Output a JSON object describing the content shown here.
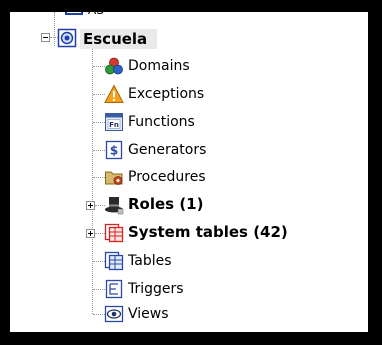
{
  "tree": {
    "partial_top_label": "AS",
    "root": {
      "label": "Escuela",
      "expanded": true
    },
    "items": [
      {
        "label": "Domains",
        "icon": "domains-icon"
      },
      {
        "label": "Exceptions",
        "icon": "exceptions-icon"
      },
      {
        "label": "Functions",
        "icon": "functions-icon",
        "icon_text": "Fn"
      },
      {
        "label": "Generators",
        "icon": "generators-icon"
      },
      {
        "label": "Procedures",
        "icon": "procedures-icon"
      },
      {
        "label": "Roles (1)",
        "icon": "roles-icon",
        "bold": true,
        "expandable": true
      },
      {
        "label": "System tables (42)",
        "icon": "system-tables-icon",
        "bold": true,
        "expandable": true
      },
      {
        "label": "Tables",
        "icon": "tables-icon"
      },
      {
        "label": "Triggers",
        "icon": "triggers-icon"
      },
      {
        "label": "Views",
        "icon": "views-icon"
      }
    ]
  },
  "colors": {
    "background": "#000000",
    "panel": "#ffffff",
    "selection": "#e9e9e9",
    "tree_lines": "#9a9a9a"
  }
}
